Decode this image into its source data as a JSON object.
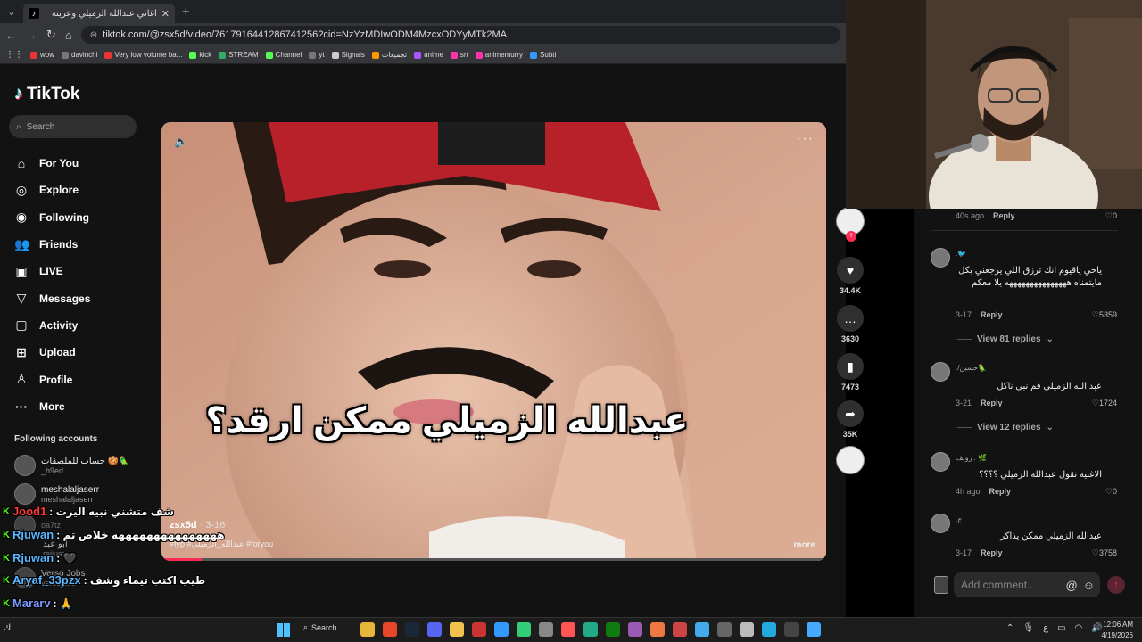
{
  "browser": {
    "tab_title": "أغاني عبدالله الزميلي وعزيته",
    "new_tab": "+",
    "url": "tiktok.com/@zsx5d/video/7617916441286741256?cid=NzYzMDIwODM4MzcxODYyMTk2MA",
    "bookmarks": [
      "wow",
      "davinchi",
      "Very low volume ba...",
      "kick",
      "STREAM",
      "Channel",
      "yt",
      "Signals",
      "تجميعات",
      "anime",
      "srt",
      "animemurry",
      "Subti"
    ]
  },
  "tiktok": {
    "logo": "TikTok",
    "search_placeholder": "Search",
    "nav": [
      {
        "label": "For You",
        "icon": "home-icon"
      },
      {
        "label": "Explore",
        "icon": "compass-icon"
      },
      {
        "label": "Following",
        "icon": "following-icon"
      },
      {
        "label": "Friends",
        "icon": "friends-icon"
      },
      {
        "label": "LIVE",
        "icon": "live-icon"
      },
      {
        "label": "Messages",
        "icon": "messages-icon"
      },
      {
        "label": "Activity",
        "icon": "activity-icon"
      },
      {
        "label": "Upload",
        "icon": "upload-icon"
      },
      {
        "label": "Profile",
        "icon": "profile-icon"
      },
      {
        "label": "More",
        "icon": "more-icon"
      }
    ],
    "following_accounts_title": "Following accounts",
    "accounts": [
      {
        "name": "حساب للملصقات 🍪🦜",
        "handle": "_h9ed"
      },
      {
        "name": "meshalaljaserr",
        "handle": "meshalaljaserr"
      },
      {
        "name": "",
        "handle": "oa7tz"
      },
      {
        "name": "ابو عبد",
        "handle": "rejiusa"
      },
      {
        "name": "Verso Jobs",
        "handle": "versojobs"
      }
    ],
    "video": {
      "caption": "عبدالله الزميلي ممكن ارقد؟",
      "author": "zsx5d",
      "date": "3-16",
      "description_overlay": "شف متشني نبيه اليرت",
      "tags": "#fyp #عبدالله_الزميلي #foryou",
      "more": "more",
      "progress": 0.06
    },
    "actions": {
      "likes": "34.4K",
      "comments": "3630",
      "saves": "7473",
      "shares": "35K"
    },
    "comments": [
      {
        "user": "",
        "text": "",
        "date": "40s ago",
        "reply": "Reply",
        "likes": "0"
      },
      {
        "user": "🐦.",
        "text": "ياحي ياقيوم انك ترزق اللي يرجعني بكل مايتمناه هههههههههههههههه يلا معكم",
        "date": "3-17",
        "reply": "Reply",
        "likes": "5359",
        "view_replies": "View 81 replies"
      },
      {
        "user": "🦜حسين/.",
        "text": "عبد الله الزميلي قم نبي ناكل",
        "date": "3-21",
        "reply": "Reply",
        "likes": "1724",
        "view_replies": "View 12 replies"
      },
      {
        "user": "🌿 . رولف",
        "text": "الاغنيه تقول عبدالله الزميلي ؟؟؟؟",
        "date": "4h ago",
        "reply": "Reply",
        "likes": "0"
      },
      {
        "user": "ج.",
        "text": "عبدالله الزميلي ممكن يذاكر",
        "date": "3-17",
        "reply": "Reply",
        "likes": "3758"
      }
    ],
    "add_comment_placeholder": "Add comment...",
    "mention_symbol": "@",
    "emoji_symbol": "☺"
  },
  "stream_chat": [
    {
      "user": "Jood1",
      "message": ": شف متشني نبيه اليرت",
      "color": "#ff3b3b"
    },
    {
      "user": "Rjuwan",
      "message": ": هههههههههههههههه خلاص تم",
      "color": "#5bb8ff"
    },
    {
      "user": "Rjuwan",
      "message": ": 🖤",
      "color": "#5bb8ff"
    },
    {
      "user": "Aryaf_33pzx",
      "message": ": طيب اكتب تيماء وشف",
      "color": "#5bb8ff"
    },
    {
      "user": "Mararv",
      "message": ": 🙏",
      "color": "#7b9bff"
    }
  ],
  "taskbar": {
    "search": "Search",
    "time": "12:06 AM",
    "date": "4/19/2026",
    "lang": "ع",
    "left_char": "ك"
  },
  "colors": {
    "accent": "#fe2c55",
    "cyan": "#25f4ee",
    "kick_green": "#53fc18"
  }
}
